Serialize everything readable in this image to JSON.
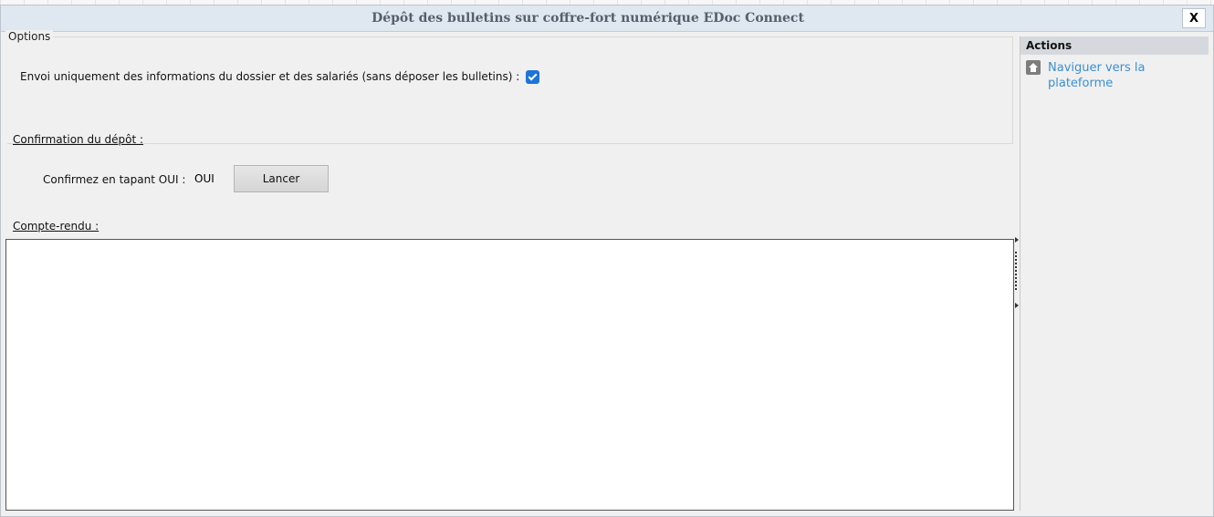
{
  "window": {
    "title": "Dépôt des bulletins sur coffre-fort numérique EDoc Connect",
    "close_label": "X"
  },
  "options": {
    "legend": "Options",
    "send_info_only_label": "Envoi uniquement des informations du dossier et des salariés (sans déposer les bulletins)  :",
    "send_info_only_checked": true
  },
  "confirmation": {
    "section_label": "Confirmation du dépôt :",
    "prompt_label": "Confirmez en tapant OUI :",
    "input_value": "OUI",
    "launch_label": "Lancer"
  },
  "report": {
    "section_label": "Compte-rendu :",
    "content": ""
  },
  "actions": {
    "header": "Actions",
    "items": [
      {
        "label": "Naviguer vers la plateforme",
        "icon": "home-icon"
      }
    ]
  },
  "colors": {
    "accent": "#1e74d8",
    "link": "#3a8fd3",
    "title_text": "#55606c",
    "titlebar_bg": "#dfe7f0"
  }
}
